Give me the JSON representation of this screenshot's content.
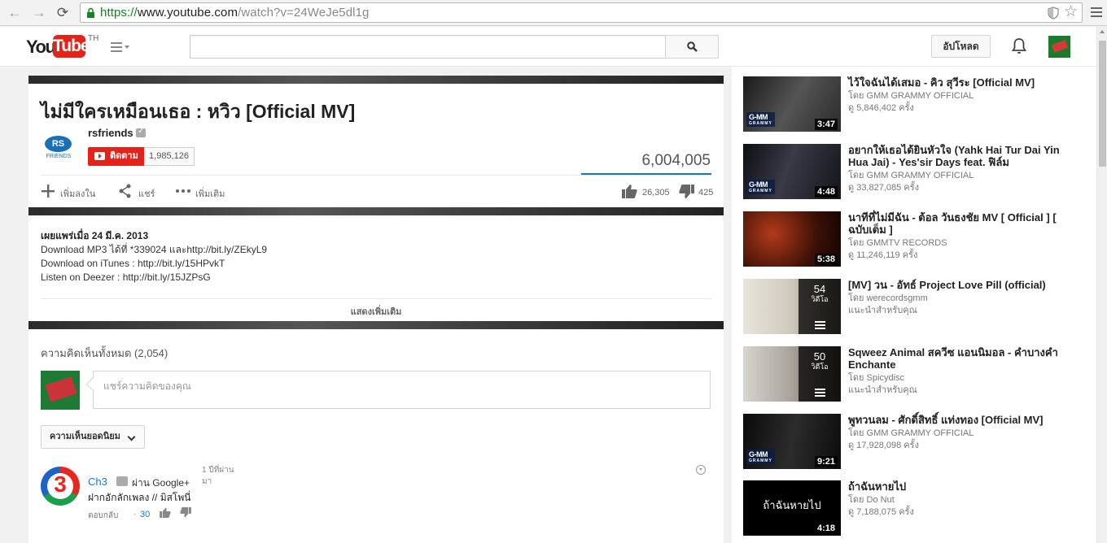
{
  "browser": {
    "url_scheme": "https://",
    "url_host": "www.youtube.com",
    "url_path": "/watch?v=24WeJe5dl1g"
  },
  "masthead": {
    "logo_you": "You",
    "logo_tube": "Tube",
    "region": "TH",
    "upload_label": "อัปโหลด",
    "search_value": ""
  },
  "video": {
    "title": "ไม่มีใครเหมือนเธอ : หวิว [Official MV]",
    "channel_logo_text": "RS",
    "channel_logo_sub": "FRIENDS",
    "channel_name": "rsfriends",
    "subscribe_label": "ติดตาม",
    "subscriber_count": "1,985,126",
    "view_count": "6,004,005",
    "actions": {
      "add_to": "เพิ่มลงใน",
      "share": "แชร์",
      "more": "เพิ่มเติม"
    },
    "likes": "26,305",
    "dislikes": "425",
    "published": "เผยแพร่เมื่อ 24 มี.ค. 2013",
    "description_lines": [
      "Download MP3 ได้ที่ *339024 และhttp://bit.ly/ZEkyL9",
      "Download on iTunes : http://bit.ly/15HPvkT",
      "Listen on Deezer : http://bit.ly/15JZPsG"
    ],
    "show_more": "แสดงเพิ่มเติม"
  },
  "comments": {
    "title": "ความคิดเห็นทั้งหมด",
    "count": "(2,054)",
    "placeholder": "แชร์ความคิดของคุณ",
    "sort_label": "ความเห็นยอดนิยม",
    "items": [
      {
        "author": "Ch3",
        "via": "ผ่าน Google+",
        "time_line1": "1 ปีที่ผ่าน",
        "time_line2": "มา",
        "text": "ฝากอักลักเพลง // มิสโพนี่",
        "reply": "ตอบกลับ",
        "dot": "·",
        "likes": "30"
      }
    ]
  },
  "related": [
    {
      "title": "ไว้ใจฉันได้เสมอ - คิว สุวีระ [Official MV]",
      "by": "โดย GMM GRAMMY OFFICIAL",
      "views": "ดู 5,846,402 ครั้ง",
      "duration": "3:47",
      "badge": "G-MM"
    },
    {
      "title": "อยากให้เธอได้ยินหัวใจ (Yahk Hai Tur Dai Yin Hua Jai) - Yes'sir Days feat. ฟิล์ม",
      "by": "โดย GMM GRAMMY OFFICIAL",
      "views": "ดู 33,827,085 ครั้ง",
      "duration": "4:48",
      "badge": "G-MM"
    },
    {
      "title": "นาทีที่ไม่มีฉัน - ต้อล วันธงชัย MV [ Official ] [ ฉบับเต็ม ]",
      "by": "โดย GMMTV RECORDS",
      "views": "ดู 11,246,119 ครั้ง",
      "duration": "5:38",
      "badge": ""
    },
    {
      "title": "[MV] วน - อัทธ์ Project Love Pill (official)",
      "by": "โดย werecordsgmm",
      "views": "แนะนำสำหรับคุณ",
      "playlist_count": "54",
      "playlist_unit": "วิดีโอ"
    },
    {
      "title": "Sqweez Animal สควีซ แอนนิมอล - คำบางคำ Enchante",
      "by": "โดย Spicydisc",
      "views": "แนะนำสำหรับคุณ",
      "playlist_count": "50",
      "playlist_unit": "วิดีโอ"
    },
    {
      "title": "พูทวนลม - ศักดิ์สิทธิ์ แท่งทอง [Official MV]",
      "by": "โดย GMM GRAMMY OFFICIAL",
      "views": "ดู 17,928,098 ครั้ง",
      "duration": "9:21",
      "badge": "G-MM"
    },
    {
      "title": "ถ้าฉันหายไป",
      "by": "โดย Do Nut",
      "views": "ดู 7,188,075 ครั้ง",
      "duration": "4:18",
      "badge": "",
      "thumb_text": "ถ้าฉันหายไป"
    }
  ],
  "colors": {
    "youtube_red": "#e62117",
    "link_blue": "#167ac6",
    "https_green": "#0a8a1a"
  }
}
